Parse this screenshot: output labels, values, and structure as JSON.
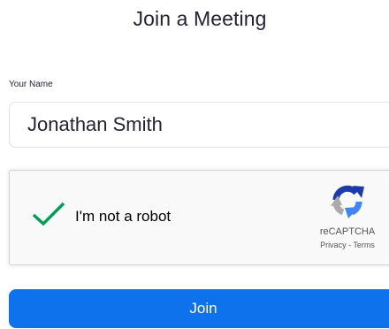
{
  "page": {
    "title": "Join a Meeting"
  },
  "name_field": {
    "label": "Your Name",
    "value": "Jonathan Smith"
  },
  "recaptcha": {
    "checked": true,
    "label": "I'm not a robot",
    "brand": "reCAPTCHA",
    "privacy_link": "Privacy",
    "separator": " - ",
    "terms_link": "Terms",
    "check_color": "#009e55",
    "checkmark_icon": "checkmark-icon",
    "logo_icon": "recaptcha-logo-icon"
  },
  "join_button": {
    "label": "Join",
    "color": "#0e72ed"
  }
}
